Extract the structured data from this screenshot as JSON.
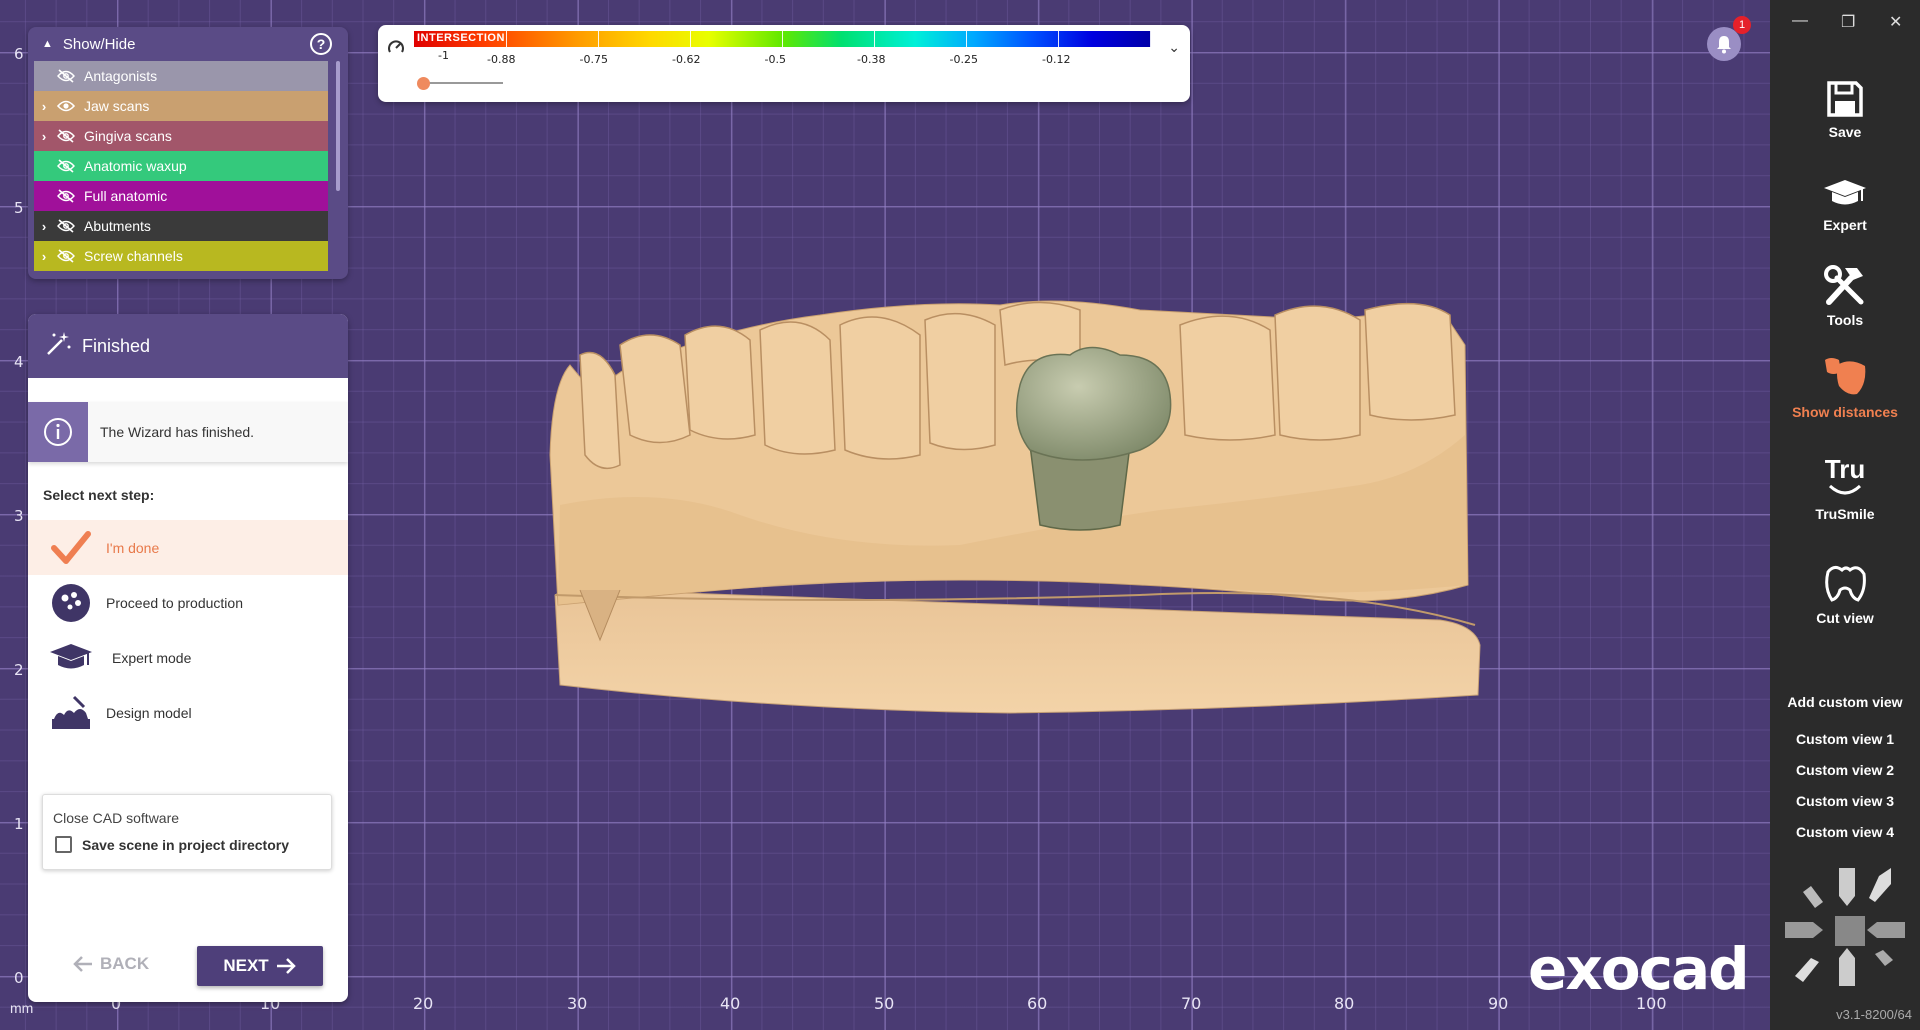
{
  "axes": {
    "y_labels": [
      "6",
      "5",
      "4",
      "3",
      "2",
      "1",
      "0"
    ],
    "x_labels": [
      "0",
      "10",
      "20",
      "30",
      "40",
      "50",
      "60",
      "70",
      "80",
      "90",
      "100"
    ],
    "unit": "mm"
  },
  "show_hide": {
    "title": "Show/Hide",
    "items": [
      {
        "label": "Antagonists",
        "color": "#9a96ab",
        "expandable": false,
        "visible": false
      },
      {
        "label": "Jaw scans",
        "color": "#c9a070",
        "expandable": true,
        "visible": true
      },
      {
        "label": "Gingiva scans",
        "color": "#a2566a",
        "expandable": true,
        "visible": false
      },
      {
        "label": "Anatomic waxup",
        "color": "#34c97c",
        "expandable": false,
        "visible": false
      },
      {
        "label": "Full anatomic",
        "color": "#a0109a",
        "expandable": false,
        "visible": false
      },
      {
        "label": "Abutments",
        "color": "#3a3a3a",
        "expandable": true,
        "visible": false
      },
      {
        "label": "Screw channels",
        "color": "#b8b820",
        "expandable": true,
        "visible": false
      }
    ]
  },
  "wizard": {
    "title": "Finished",
    "info": "The Wizard has finished.",
    "select_label": "Select next step:",
    "steps": [
      {
        "label": "I'm done",
        "icon": "checkmark-icon",
        "active": true
      },
      {
        "label": "Proceed to production",
        "icon": "production-icon",
        "active": false
      },
      {
        "label": "Expert mode",
        "icon": "graduation-cap-icon",
        "active": false
      },
      {
        "label": "Design model",
        "icon": "design-model-icon",
        "active": false
      }
    ],
    "close": {
      "title": "Close CAD software",
      "checkbox_label": "Save scene in project directory",
      "checked": false
    },
    "back_label": "BACK",
    "next_label": "NEXT"
  },
  "colorbar": {
    "title": "INTERSECTION",
    "labels": [
      "-1",
      "-0.88",
      "-0.75",
      "-0.62",
      "-0.5",
      "-0.38",
      "-0.25",
      "-0.12"
    ]
  },
  "notifications": {
    "count": "1"
  },
  "sidebar": {
    "window_controls": [
      "—",
      "❐",
      "✕"
    ],
    "items": [
      {
        "label": "Save",
        "icon": "save-icon"
      },
      {
        "label": "Expert",
        "icon": "graduation-cap-icon"
      },
      {
        "label": "Tools",
        "icon": "tools-icon"
      },
      {
        "label": "Show distances",
        "icon": "show-distances-icon",
        "active": true
      },
      {
        "label": "TruSmile",
        "icon": "trusmile-icon"
      },
      {
        "label": "Cut view",
        "icon": "cut-view-icon"
      }
    ],
    "add_custom_view": "Add custom view",
    "custom_views": [
      "Custom view 1",
      "Custom view 2",
      "Custom view 3",
      "Custom view 4"
    ],
    "version": "v3.1-8200/64"
  },
  "logo_text": "exocad",
  "accent_color": "#f08050"
}
